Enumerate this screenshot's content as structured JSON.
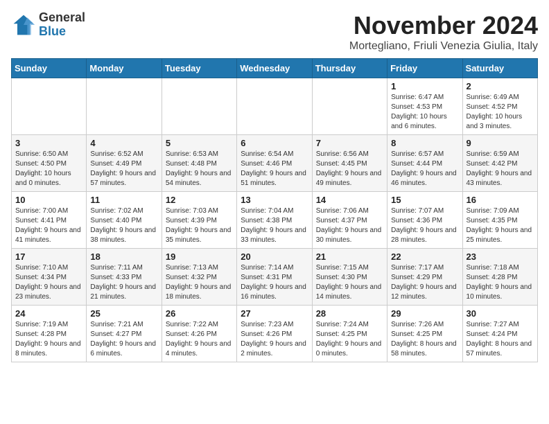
{
  "logo": {
    "general": "General",
    "blue": "Blue"
  },
  "title": {
    "month": "November 2024",
    "location": "Mortegliano, Friuli Venezia Giulia, Italy"
  },
  "headers": [
    "Sunday",
    "Monday",
    "Tuesday",
    "Wednesday",
    "Thursday",
    "Friday",
    "Saturday"
  ],
  "weeks": [
    [
      {
        "day": "",
        "info": ""
      },
      {
        "day": "",
        "info": ""
      },
      {
        "day": "",
        "info": ""
      },
      {
        "day": "",
        "info": ""
      },
      {
        "day": "",
        "info": ""
      },
      {
        "day": "1",
        "info": "Sunrise: 6:47 AM\nSunset: 4:53 PM\nDaylight: 10 hours and 6 minutes."
      },
      {
        "day": "2",
        "info": "Sunrise: 6:49 AM\nSunset: 4:52 PM\nDaylight: 10 hours and 3 minutes."
      }
    ],
    [
      {
        "day": "3",
        "info": "Sunrise: 6:50 AM\nSunset: 4:50 PM\nDaylight: 10 hours and 0 minutes."
      },
      {
        "day": "4",
        "info": "Sunrise: 6:52 AM\nSunset: 4:49 PM\nDaylight: 9 hours and 57 minutes."
      },
      {
        "day": "5",
        "info": "Sunrise: 6:53 AM\nSunset: 4:48 PM\nDaylight: 9 hours and 54 minutes."
      },
      {
        "day": "6",
        "info": "Sunrise: 6:54 AM\nSunset: 4:46 PM\nDaylight: 9 hours and 51 minutes."
      },
      {
        "day": "7",
        "info": "Sunrise: 6:56 AM\nSunset: 4:45 PM\nDaylight: 9 hours and 49 minutes."
      },
      {
        "day": "8",
        "info": "Sunrise: 6:57 AM\nSunset: 4:44 PM\nDaylight: 9 hours and 46 minutes."
      },
      {
        "day": "9",
        "info": "Sunrise: 6:59 AM\nSunset: 4:42 PM\nDaylight: 9 hours and 43 minutes."
      }
    ],
    [
      {
        "day": "10",
        "info": "Sunrise: 7:00 AM\nSunset: 4:41 PM\nDaylight: 9 hours and 41 minutes."
      },
      {
        "day": "11",
        "info": "Sunrise: 7:02 AM\nSunset: 4:40 PM\nDaylight: 9 hours and 38 minutes."
      },
      {
        "day": "12",
        "info": "Sunrise: 7:03 AM\nSunset: 4:39 PM\nDaylight: 9 hours and 35 minutes."
      },
      {
        "day": "13",
        "info": "Sunrise: 7:04 AM\nSunset: 4:38 PM\nDaylight: 9 hours and 33 minutes."
      },
      {
        "day": "14",
        "info": "Sunrise: 7:06 AM\nSunset: 4:37 PM\nDaylight: 9 hours and 30 minutes."
      },
      {
        "day": "15",
        "info": "Sunrise: 7:07 AM\nSunset: 4:36 PM\nDaylight: 9 hours and 28 minutes."
      },
      {
        "day": "16",
        "info": "Sunrise: 7:09 AM\nSunset: 4:35 PM\nDaylight: 9 hours and 25 minutes."
      }
    ],
    [
      {
        "day": "17",
        "info": "Sunrise: 7:10 AM\nSunset: 4:34 PM\nDaylight: 9 hours and 23 minutes."
      },
      {
        "day": "18",
        "info": "Sunrise: 7:11 AM\nSunset: 4:33 PM\nDaylight: 9 hours and 21 minutes."
      },
      {
        "day": "19",
        "info": "Sunrise: 7:13 AM\nSunset: 4:32 PM\nDaylight: 9 hours and 18 minutes."
      },
      {
        "day": "20",
        "info": "Sunrise: 7:14 AM\nSunset: 4:31 PM\nDaylight: 9 hours and 16 minutes."
      },
      {
        "day": "21",
        "info": "Sunrise: 7:15 AM\nSunset: 4:30 PM\nDaylight: 9 hours and 14 minutes."
      },
      {
        "day": "22",
        "info": "Sunrise: 7:17 AM\nSunset: 4:29 PM\nDaylight: 9 hours and 12 minutes."
      },
      {
        "day": "23",
        "info": "Sunrise: 7:18 AM\nSunset: 4:28 PM\nDaylight: 9 hours and 10 minutes."
      }
    ],
    [
      {
        "day": "24",
        "info": "Sunrise: 7:19 AM\nSunset: 4:28 PM\nDaylight: 9 hours and 8 minutes."
      },
      {
        "day": "25",
        "info": "Sunrise: 7:21 AM\nSunset: 4:27 PM\nDaylight: 9 hours and 6 minutes."
      },
      {
        "day": "26",
        "info": "Sunrise: 7:22 AM\nSunset: 4:26 PM\nDaylight: 9 hours and 4 minutes."
      },
      {
        "day": "27",
        "info": "Sunrise: 7:23 AM\nSunset: 4:26 PM\nDaylight: 9 hours and 2 minutes."
      },
      {
        "day": "28",
        "info": "Sunrise: 7:24 AM\nSunset: 4:25 PM\nDaylight: 9 hours and 0 minutes."
      },
      {
        "day": "29",
        "info": "Sunrise: 7:26 AM\nSunset: 4:25 PM\nDaylight: 8 hours and 58 minutes."
      },
      {
        "day": "30",
        "info": "Sunrise: 7:27 AM\nSunset: 4:24 PM\nDaylight: 8 hours and 57 minutes."
      }
    ]
  ]
}
